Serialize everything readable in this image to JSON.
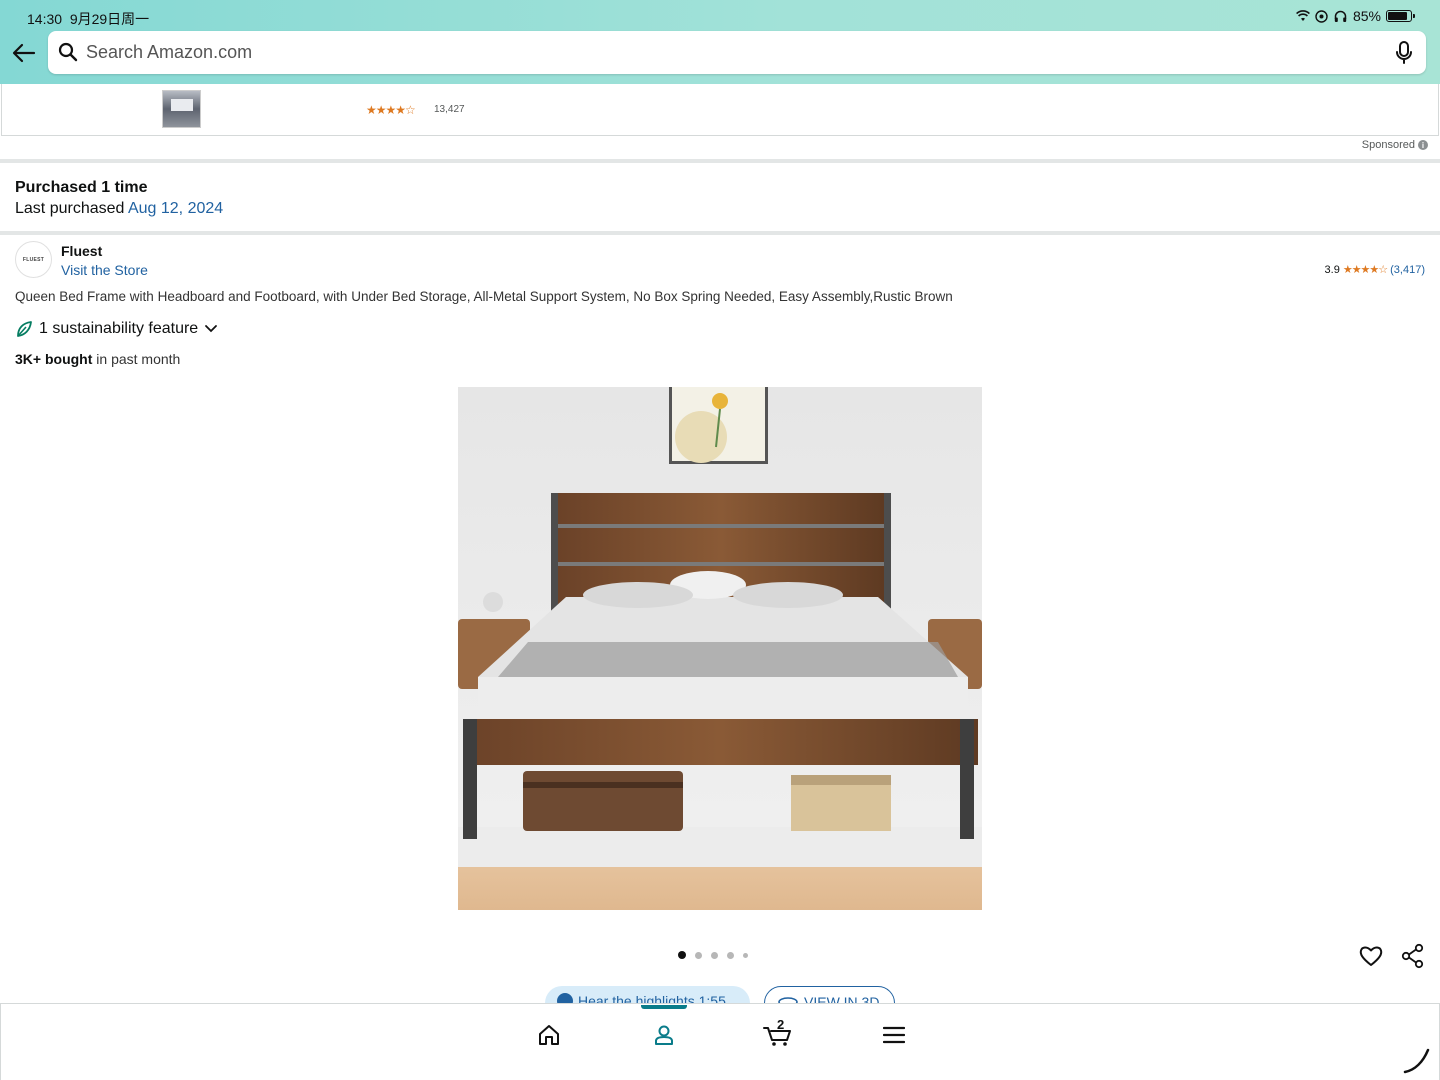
{
  "status_bar": {
    "time": "14:30",
    "date": "9月29日周一",
    "battery": "85%",
    "battery_level": 0.85
  },
  "search": {
    "placeholder": "Search Amazon.com"
  },
  "sponsored_strip": {
    "stars": "★★★★☆",
    "rating_count": "13,427",
    "label": "Sponsored"
  },
  "purchase_history": {
    "title": "Purchased 1 time",
    "last_label": "Last purchased",
    "last_date": "Aug 12, 2024"
  },
  "brand": {
    "logo_text": "FLUEST",
    "name": "Fluest",
    "visit_store": "Visit the Store"
  },
  "rating": {
    "value": "3.9",
    "stars": "★★★★☆",
    "count": "(3,417)"
  },
  "product": {
    "title": "Queen Bed Frame with Headboard and Footboard, with Under Bed Storage, All-Metal Support System, No Box Spring Needed, Easy Assembly,Rustic Brown",
    "sustainability": "1 sustainability feature",
    "bought_bold": "3K+ bought",
    "bought_rest": " in past month"
  },
  "gallery": {
    "image_count": 5,
    "active_index": 0
  },
  "actions": {
    "hear_highlights": "Hear the highlights 1:55",
    "view_3d": "VIEW IN 3D"
  },
  "bottom_nav": {
    "cart_count": "2",
    "active": "account"
  },
  "colors": {
    "link": "#2162a1",
    "star": "#de7921",
    "header_start": "#84d8d4",
    "header_end": "#a8e4d6",
    "nav_active": "#0a7c8a"
  }
}
